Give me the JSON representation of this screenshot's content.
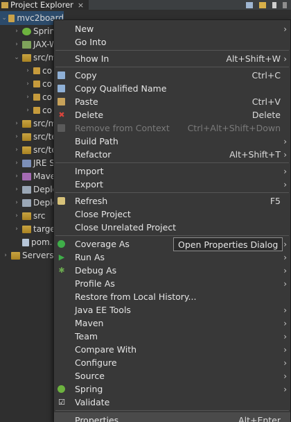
{
  "view": {
    "tab_title": "Project Explorer",
    "close_glyph": "×"
  },
  "tree": [
    {
      "label": "mvc2board",
      "twisty": "⌄",
      "indent": 0,
      "icon": "project-icon",
      "selected": true
    },
    {
      "label": "Sprin",
      "twisty": "›",
      "indent": 1,
      "icon": "spring-icon"
    },
    {
      "label": "JAX-W",
      "twisty": "›",
      "indent": 1,
      "icon": "webservice-icon"
    },
    {
      "label": "src/m",
      "twisty": "⌄",
      "indent": 1,
      "icon": "source-folder-icon"
    },
    {
      "label": "co",
      "twisty": "›",
      "indent": 2,
      "icon": "package-icon"
    },
    {
      "label": "co",
      "twisty": "›",
      "indent": 2,
      "icon": "package-icon"
    },
    {
      "label": "co",
      "twisty": "›",
      "indent": 2,
      "icon": "package-icon"
    },
    {
      "label": "co",
      "twisty": "›",
      "indent": 2,
      "icon": "package-icon"
    },
    {
      "label": "src/m",
      "twisty": "›",
      "indent": 1,
      "icon": "source-folder-icon"
    },
    {
      "label": "src/te",
      "twisty": "›",
      "indent": 1,
      "icon": "source-folder-icon"
    },
    {
      "label": "src/te",
      "twisty": "›",
      "indent": 1,
      "icon": "source-folder-icon"
    },
    {
      "label": "JRE S",
      "twisty": "›",
      "indent": 1,
      "icon": "jre-library-icon"
    },
    {
      "label": "Mave",
      "twisty": "›",
      "indent": 1,
      "icon": "maven-library-icon"
    },
    {
      "label": "Deplo",
      "twisty": "›",
      "indent": 1,
      "icon": "deployed-resources-icon"
    },
    {
      "label": "Deplo",
      "twisty": "›",
      "indent": 1,
      "icon": "deployment-descriptor-icon"
    },
    {
      "label": "src",
      "twisty": "›",
      "indent": 1,
      "icon": "folder-icon"
    },
    {
      "label": "targe",
      "twisty": "›",
      "indent": 1,
      "icon": "folder-icon"
    },
    {
      "label": "pom.",
      "twisty": "",
      "indent": 1,
      "icon": "xml-file-icon"
    },
    {
      "label": "Servers",
      "twisty": "›",
      "indent": 0,
      "icon": "folder-icon"
    }
  ],
  "menu": [
    {
      "type": "item",
      "label": "New",
      "submenu": true
    },
    {
      "type": "item",
      "label": "Go Into"
    },
    {
      "type": "sep"
    },
    {
      "type": "item",
      "label": "Show In",
      "shortcut": "Alt+Shift+W",
      "submenu": true
    },
    {
      "type": "sep"
    },
    {
      "type": "item",
      "label": "Copy",
      "shortcut": "Ctrl+C",
      "icon": "copy-icon"
    },
    {
      "type": "item",
      "label": "Copy Qualified Name",
      "icon": "copy-qualified-name-icon"
    },
    {
      "type": "item",
      "label": "Paste",
      "shortcut": "Ctrl+V",
      "icon": "paste-icon"
    },
    {
      "type": "item",
      "label": "Delete",
      "shortcut": "Delete",
      "icon": "delete-icon"
    },
    {
      "type": "item",
      "label": "Remove from Context",
      "shortcut": "Ctrl+Alt+Shift+Down",
      "disabled": true,
      "icon": "remove-context-icon"
    },
    {
      "type": "item",
      "label": "Build Path",
      "submenu": true
    },
    {
      "type": "item",
      "label": "Refactor",
      "shortcut": "Alt+Shift+T",
      "submenu": true
    },
    {
      "type": "sep"
    },
    {
      "type": "item",
      "label": "Import",
      "submenu": true
    },
    {
      "type": "item",
      "label": "Export",
      "submenu": true
    },
    {
      "type": "sep"
    },
    {
      "type": "item",
      "label": "Refresh",
      "shortcut": "F5",
      "icon": "refresh-icon"
    },
    {
      "type": "item",
      "label": "Close Project"
    },
    {
      "type": "item",
      "label": "Close Unrelated Project"
    },
    {
      "type": "sep"
    },
    {
      "type": "item",
      "label": "Coverage As",
      "submenu": true,
      "icon": "coverage-icon"
    },
    {
      "type": "item",
      "label": "Run As",
      "submenu": true,
      "icon": "run-icon"
    },
    {
      "type": "item",
      "label": "Debug As",
      "submenu": true,
      "icon": "debug-icon"
    },
    {
      "type": "item",
      "label": "Profile As",
      "submenu": true
    },
    {
      "type": "item",
      "label": "Restore from Local History..."
    },
    {
      "type": "item",
      "label": "Java EE Tools",
      "submenu": true
    },
    {
      "type": "item",
      "label": "Maven",
      "submenu": true
    },
    {
      "type": "item",
      "label": "Team",
      "submenu": true
    },
    {
      "type": "item",
      "label": "Compare With",
      "submenu": true
    },
    {
      "type": "item",
      "label": "Configure",
      "submenu": true
    },
    {
      "type": "item",
      "label": "Source",
      "submenu": true
    },
    {
      "type": "item",
      "label": "Spring",
      "submenu": true,
      "icon": "spring-icon"
    },
    {
      "type": "item",
      "label": "Validate",
      "icon": "validate-checkbox-icon"
    },
    {
      "type": "sep"
    },
    {
      "type": "item",
      "label": "Properties",
      "shortcut": "Alt+Enter",
      "hover": true
    }
  ],
  "tooltip": "Open Properties Dialog",
  "colors": {
    "menu_bg": "#383838",
    "hover_bg": "#4a4a4a",
    "selection": "#2c4b6b",
    "delete_red": "#d9453c",
    "run_green": "#3fae49",
    "spring_green": "#6db33f"
  }
}
